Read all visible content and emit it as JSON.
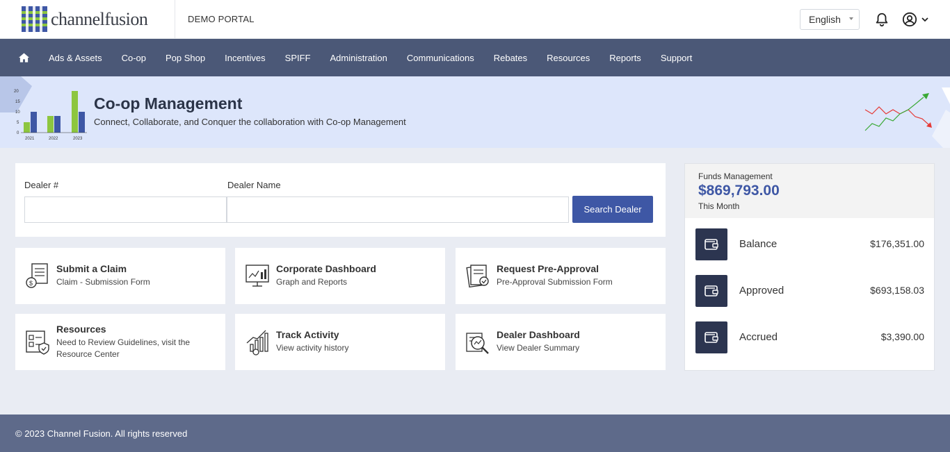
{
  "header": {
    "logo_text": "channelfusion",
    "portal_label": "DEMO PORTAL",
    "language": "English"
  },
  "nav": {
    "items": [
      "Ads & Assets",
      "Co-op",
      "Pop Shop",
      "Incentives",
      "SPIFF",
      "Administration",
      "Communications",
      "Rebates",
      "Resources",
      "Reports",
      "Support"
    ]
  },
  "banner": {
    "title": "Co-op Management",
    "subtitle": "Connect, Collaborate, and Conquer the collaboration with Co-op Management",
    "chart_ticks": [
      "20",
      "15",
      "10",
      "5",
      "0"
    ],
    "chart_years": [
      "2021",
      "2022",
      "2023"
    ]
  },
  "search": {
    "dealer_num_label": "Dealer #",
    "dealer_name_label": "Dealer Name",
    "dealer_num_value": "",
    "dealer_name_value": "",
    "button_label": "Search Dealer"
  },
  "tiles": [
    {
      "title": "Submit a Claim",
      "sub": "Claim - Submission Form",
      "icon": "claim-form-icon"
    },
    {
      "title": "Corporate Dashboard",
      "sub": "Graph and Reports",
      "icon": "dashboard-monitor-icon"
    },
    {
      "title": "Request Pre-Approval",
      "sub": "Pre-Approval Submission Form",
      "icon": "approval-document-icon"
    },
    {
      "title": "Resources",
      "sub": "Need to Review Guidelines, visit the Resource Center",
      "icon": "guidelines-document-icon"
    },
    {
      "title": "Track Activity",
      "sub": "View activity history",
      "icon": "activity-chart-icon"
    },
    {
      "title": "Dealer Dashboard",
      "sub": "View Dealer Summary",
      "icon": "dealer-search-icon"
    }
  ],
  "funds": {
    "label": "Funds Management",
    "amount": "$869,793.00",
    "period": "This Month",
    "rows": [
      {
        "name": "Balance",
        "value": "$176,351.00"
      },
      {
        "name": "Approved",
        "value": "$693,158.03"
      },
      {
        "name": "Accrued",
        "value": "$3,390.00"
      }
    ]
  },
  "footer": {
    "text": "© 2023 Channel Fusion. All rights reserved"
  },
  "colors": {
    "nav_bg": "#4b5877",
    "accent": "#3e57a5",
    "banner_bg": "#dde6fb",
    "footer_bg": "#5e6a8a",
    "wallet_bg": "#2c3550"
  }
}
